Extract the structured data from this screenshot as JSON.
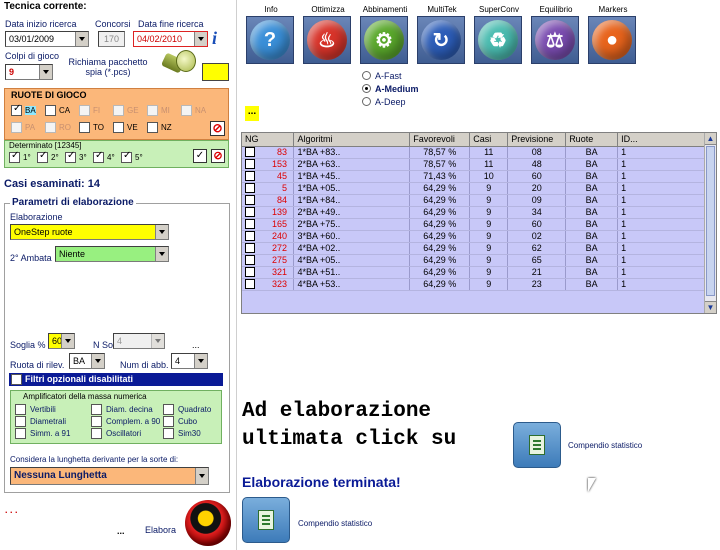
{
  "header": {
    "title": "Tecnica corrente:"
  },
  "fields": {
    "data_inizio_label": "Data inizio ricerca",
    "data_inizio": "03/01/2009",
    "concorsi_label": "Concorsi",
    "concorsi": "170",
    "data_fine_label": "Data fine ricerca",
    "data_fine": "04/02/2010",
    "colpi_label": "Colpi di gioco",
    "colpi": "9",
    "richiama_label": "Richiama pacchetto spia (*.pcs)"
  },
  "ruote": {
    "title": "RUOTE DI GIOCO",
    "row1": [
      {
        "label": "BA",
        "checked": true
      },
      {
        "label": "CA",
        "checked": false
      },
      {
        "label": "FI",
        "checked": false,
        "disabled": true
      },
      {
        "label": "GE",
        "checked": false,
        "disabled": true
      },
      {
        "label": "MI",
        "checked": false,
        "disabled": true
      },
      {
        "label": "NA",
        "checked": false,
        "disabled": true
      }
    ],
    "row2": [
      {
        "label": "PA",
        "checked": false,
        "disabled": true
      },
      {
        "label": "RO",
        "checked": false,
        "disabled": true
      },
      {
        "label": "TO",
        "checked": false
      },
      {
        "label": "VE",
        "checked": false
      },
      {
        "label": "NZ",
        "checked": false
      }
    ]
  },
  "determinato": {
    "title": "Determinato [12345]",
    "items": [
      {
        "label": "1°",
        "checked": true
      },
      {
        "label": "2°",
        "checked": true
      },
      {
        "label": "3°",
        "checked": true
      },
      {
        "label": "4°",
        "checked": true
      },
      {
        "label": "5°",
        "checked": true
      }
    ]
  },
  "casi_esaminati": "Casi esaminati: 14",
  "parametri": {
    "title": "Parametri di elaborazione",
    "elaborazione_label": "Elaborazione",
    "elaborazione": "OneStep ruote",
    "ambata_label": "2° Ambata",
    "ambata": "Niente",
    "soglia_label": "Soglia %",
    "soglia": "60",
    "nsoluz_label": "N Soluz.",
    "nsoluz": "4",
    "dots": "...",
    "ruota_rilev_label": "Ruota di rilev.",
    "ruota_rilev": "BA",
    "num_abb_label": "Num di abb.",
    "num_abb": "4",
    "filtri": "Filtri opzionali disabilitati",
    "amplificatori_title": "Amplificatori della massa numerica",
    "amplificatori": [
      "Vertibili",
      "Diam. decina",
      "Quadrato",
      "Diametrali",
      "Complem. a 90",
      "Cubo",
      "Simm. a 91",
      "Oscillatori",
      "Sim30"
    ],
    "lunghetta_label": "Considera la lunghetta derivante per la sorte di:",
    "lunghetta": "Nessuna Lunghetta"
  },
  "bottom_left": {
    "dots1": ". . .",
    "dots2": "...",
    "elabora": "Elabora"
  },
  "toolbar": [
    {
      "label": "Info",
      "icon": "question-icon",
      "color": "#3a8fd8",
      "glyph": "?"
    },
    {
      "label": "Ottimizza",
      "icon": "flame-icon",
      "color": "#d8342a",
      "glyph": "♨"
    },
    {
      "label": "Abbinamenti",
      "icon": "gear-icon",
      "color": "#5aa82c",
      "glyph": "⚙"
    },
    {
      "label": "MultiTek",
      "icon": "swirl-icon",
      "color": "#2c5db8",
      "glyph": "↻"
    },
    {
      "label": "SuperConv",
      "icon": "recycle-icon",
      "color": "#4abcb0",
      "glyph": "♻"
    },
    {
      "label": "Equilibrio",
      "icon": "scale-icon",
      "color": "#7a4cb0",
      "glyph": "⚖"
    },
    {
      "label": "Markers",
      "icon": "ball-icon",
      "color": "#e8641c",
      "glyph": "●"
    }
  ],
  "modes": [
    {
      "label": "A-Fast",
      "selected": false
    },
    {
      "label": "A-Medium",
      "selected": true
    },
    {
      "label": "A-Deep",
      "selected": false
    }
  ],
  "yellow_dots": "...",
  "table": {
    "columns": [
      "NG",
      "Algoritmi",
      "Favorevoli",
      "Casi",
      "Previsione",
      "Ruote",
      "ID..."
    ],
    "rows": [
      [
        "83",
        "1*BA +83..",
        "78,57 %",
        "11",
        "08",
        "BA",
        "1"
      ],
      [
        "153",
        "2*BA +63..",
        "78,57 %",
        "11",
        "48",
        "BA",
        "1"
      ],
      [
        "45",
        "1*BA +45..",
        "71,43 %",
        "10",
        "60",
        "BA",
        "1"
      ],
      [
        "5",
        "1*BA +05..",
        "64,29 %",
        "9",
        "20",
        "BA",
        "1"
      ],
      [
        "84",
        "1*BA +84..",
        "64,29 %",
        "9",
        "09",
        "BA",
        "1"
      ],
      [
        "139",
        "2*BA +49..",
        "64,29 %",
        "9",
        "34",
        "BA",
        "1"
      ],
      [
        "165",
        "2*BA +75..",
        "64,29 %",
        "9",
        "60",
        "BA",
        "1"
      ],
      [
        "240",
        "3*BA +60..",
        "64,29 %",
        "9",
        "02",
        "BA",
        "1"
      ],
      [
        "272",
        "4*BA +02..",
        "64,29 %",
        "9",
        "62",
        "BA",
        "1"
      ],
      [
        "275",
        "4*BA +05..",
        "64,29 %",
        "9",
        "65",
        "BA",
        "1"
      ],
      [
        "321",
        "4*BA +51..",
        "64,29 %",
        "9",
        "21",
        "BA",
        "1"
      ],
      [
        "323",
        "4*BA +53..",
        "64,29 %",
        "9",
        "23",
        "BA",
        "1"
      ]
    ]
  },
  "message": {
    "line1": "Ad elaborazione",
    "line2": "ultimata click su",
    "compendio": "Compendio statistico",
    "done": "Elaborazione terminata!",
    "compendio2": "Compendio statistico"
  }
}
